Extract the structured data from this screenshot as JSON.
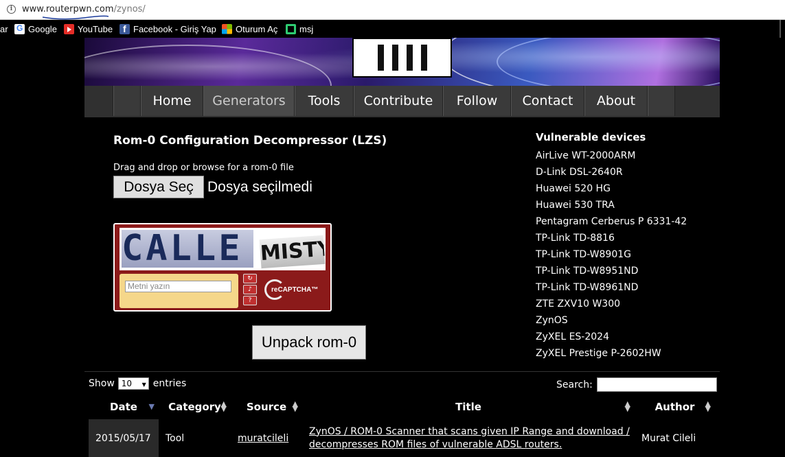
{
  "browser": {
    "url_host": "www.routerpwn.com",
    "url_path": "/zynos/",
    "bookmarks": [
      {
        "label": "ar",
        "icon": "none"
      },
      {
        "label": "Google",
        "icon": "google-icon"
      },
      {
        "label": "YouTube",
        "icon": "youtube-icon"
      },
      {
        "label": "Facebook - Giriş Yap",
        "icon": "facebook-icon"
      },
      {
        "label": "Oturum Aç",
        "icon": "microsoft-icon"
      },
      {
        "label": "msj",
        "icon": "msj-icon"
      }
    ]
  },
  "nav": {
    "items": [
      "Home",
      "Generators",
      "Tools",
      "Contribute",
      "Follow",
      "Contact",
      "About"
    ],
    "active": "Generators"
  },
  "tool": {
    "title": "Rom-0 Configuration Decompressor (LZS)",
    "drop_label": "Drag and drop or browse for a rom-0 file",
    "file_button": "Dosya Seç",
    "file_status": "Dosya seçilmedi",
    "unpack_button": "Unpack rom-0"
  },
  "captcha": {
    "word1": "CALLE",
    "word2": "MISTY",
    "input_placeholder": "Metni yazın",
    "brand": "reCAPTCHA™"
  },
  "vulnerable": {
    "title": "Vulnerable devices",
    "devices": [
      "AirLive WT-2000ARM",
      "D-Link DSL-2640R",
      "Huawei 520 HG",
      "Huawei 530 TRA",
      "Pentagram Cerberus P 6331-42",
      "TP-Link TD-8816",
      "TP-Link TD-W8901G",
      "TP-Link TD-W8951ND",
      "TP-Link TD-W8961ND",
      "ZTE ZXV10 W300",
      "ZynOS",
      "ZyXEL ES-2024",
      "ZyXEL Prestige P-2602HW"
    ]
  },
  "table": {
    "show_label": "Show",
    "show_value": "10",
    "entries_label": "entries",
    "search_label": "Search:",
    "columns": [
      "Date",
      "Category",
      "Source",
      "Title",
      "Author"
    ],
    "rows": [
      {
        "date": "2015/05/17",
        "category": "Tool",
        "source": "muratcileli",
        "title_line1": "ZynOS / ROM-0 Scanner that scans given IP Range and download /",
        "title_line2": "decompresses ROM files of vulnerable ADSL routers.",
        "author": "Murat Cileli"
      }
    ]
  }
}
